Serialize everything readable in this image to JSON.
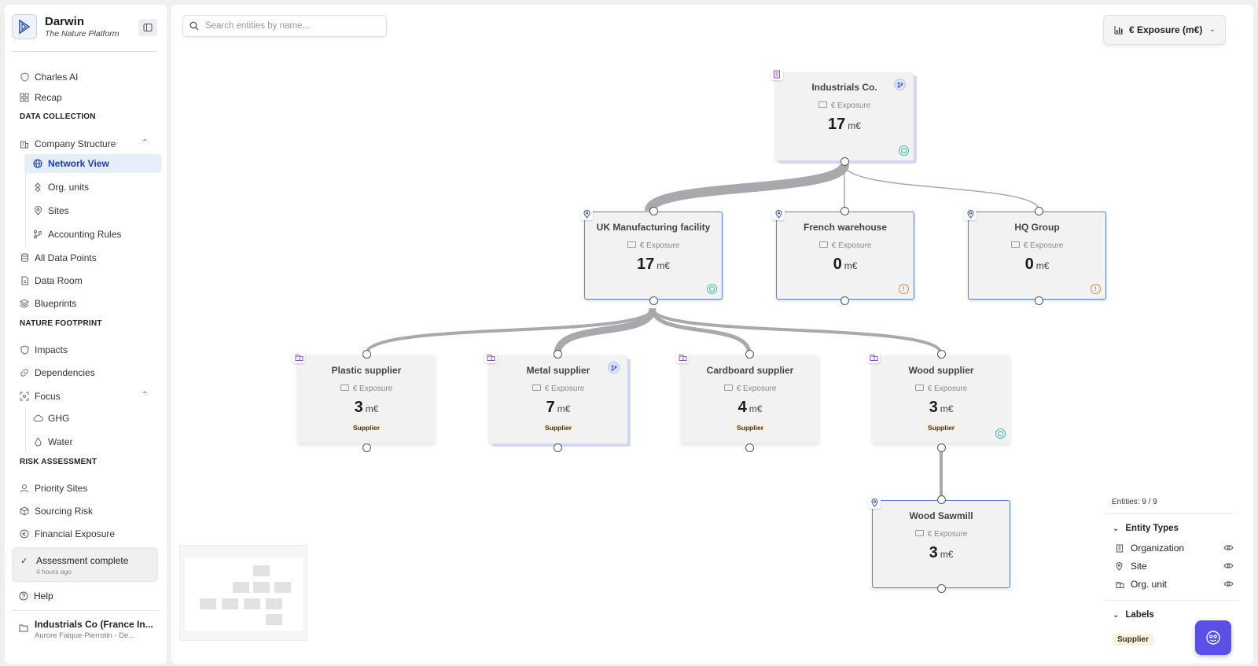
{
  "brand": {
    "name": "Darwin",
    "tagline": "The Nature Platform"
  },
  "sidebar": {
    "top_items": [
      {
        "label": "Charles AI",
        "icon": "shield-icon"
      },
      {
        "label": "Recap",
        "icon": "grid-icon"
      }
    ],
    "data_collection": {
      "title": "DATA COLLECTION",
      "company_structure": "Company Structure",
      "sub_items": [
        {
          "label": "Network View",
          "icon": "globe-icon",
          "active": true
        },
        {
          "label": "Org. units",
          "icon": "nodes-icon"
        },
        {
          "label": "Sites",
          "icon": "pin-icon"
        },
        {
          "label": "Accounting Rules",
          "icon": "branch-icon"
        }
      ],
      "items": [
        {
          "label": "All Data Points",
          "icon": "database-icon"
        },
        {
          "label": "Data Room",
          "icon": "file-icon"
        },
        {
          "label": "Blueprints",
          "icon": "layers-icon"
        }
      ]
    },
    "nature_footprint": {
      "title": "NATURE FOOTPRINT",
      "items": [
        {
          "label": "Impacts",
          "icon": "shield-icon"
        },
        {
          "label": "Dependencies",
          "icon": "link-icon"
        }
      ],
      "focus": "Focus",
      "focus_items": [
        {
          "label": "GHG",
          "icon": "cloud-icon"
        },
        {
          "label": "Water",
          "icon": "drop-icon"
        }
      ]
    },
    "risk_assessment": {
      "title": "RISK ASSESSMENT",
      "items": [
        {
          "label": "Priority Sites",
          "icon": "user-pin-icon"
        },
        {
          "label": "Sourcing Risk",
          "icon": "box-icon"
        },
        {
          "label": "Financial Exposure",
          "icon": "coin-icon"
        }
      ]
    },
    "assessment": {
      "title": "Assessment complete",
      "time": "4 hours ago"
    },
    "help": "Help",
    "org": {
      "name": "Industrials Co (France In...",
      "user": "Aurore Falque-Pierrotin - De..."
    }
  },
  "canvas": {
    "search_placeholder": "Search entities by name...",
    "metric_selector": "€ Exposure (m€)",
    "metric_label": "€ Exposure",
    "unit": "m€",
    "nodes": [
      {
        "id": "n0",
        "title": "Industrials Co.",
        "value": "17",
        "type": "organization",
        "tag": "",
        "status": "ok",
        "branch": true
      },
      {
        "id": "n1",
        "title": "UK Manufacturing facility",
        "value": "17",
        "type": "site",
        "tag": "",
        "status": "ok",
        "branch": false
      },
      {
        "id": "n2",
        "title": "French warehouse",
        "value": "0",
        "type": "site",
        "tag": "",
        "status": "warn",
        "branch": false
      },
      {
        "id": "n3",
        "title": "HQ Group",
        "value": "0",
        "type": "site",
        "tag": "",
        "status": "warn",
        "branch": false
      },
      {
        "id": "n4",
        "title": "Plastic supplier",
        "value": "3",
        "type": "org-unit",
        "tag": "Supplier",
        "status": "",
        "branch": false
      },
      {
        "id": "n5",
        "title": "Metal supplier",
        "value": "7",
        "type": "org-unit",
        "tag": "Supplier",
        "status": "",
        "branch": true
      },
      {
        "id": "n6",
        "title": "Cardboard supplier",
        "value": "4",
        "type": "org-unit",
        "tag": "Supplier",
        "status": "",
        "branch": false
      },
      {
        "id": "n7",
        "title": "Wood supplier",
        "value": "3",
        "type": "org-unit",
        "tag": "Supplier",
        "status": "ok",
        "branch": false
      },
      {
        "id": "n8",
        "title": "Wood Sawmill",
        "value": "3",
        "type": "site",
        "tag": "",
        "status": "",
        "branch": false
      }
    ]
  },
  "legend": {
    "count": "Entities: 9 / 9",
    "entity_types_title": "Entity Types",
    "entity_types": [
      {
        "label": "Organization",
        "icon": "building-icon"
      },
      {
        "label": "Site",
        "icon": "pin-icon"
      },
      {
        "label": "Org. unit",
        "icon": "org-unit-icon"
      }
    ],
    "labels_title": "Labels",
    "labels": [
      "Supplier"
    ]
  },
  "colors": {
    "accent": "#1d3fae",
    "site_border": "#5b7de0",
    "assistant": "#5a4fe6",
    "status_ok": "#3fb9a3",
    "status_warn": "#e48a2e",
    "supplier_tag": "#fdf0dc"
  }
}
